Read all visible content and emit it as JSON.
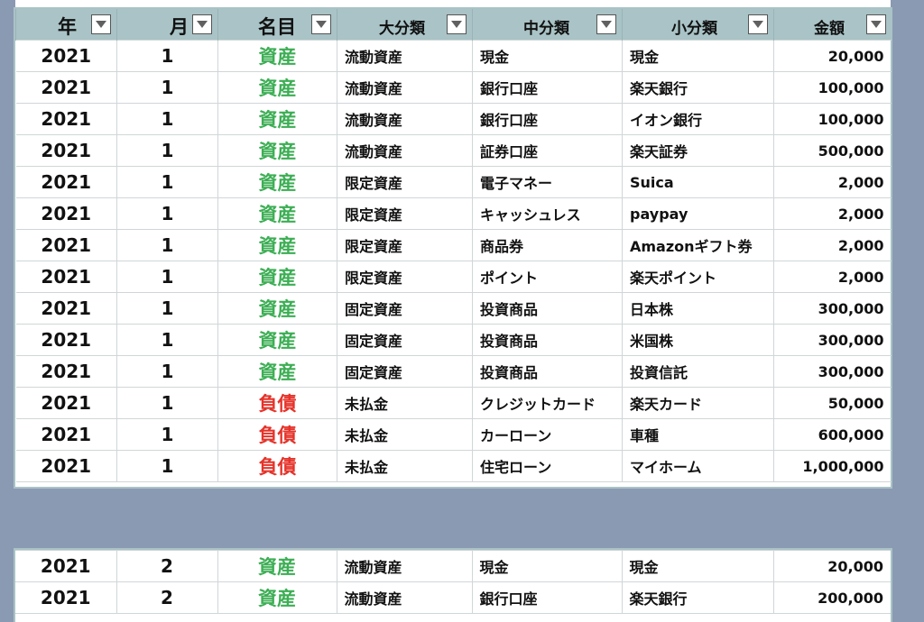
{
  "header": {
    "year": "年",
    "month": "月",
    "name": "名目",
    "major": "大分類",
    "middle": "中分類",
    "minor": "小分類",
    "amount": "金額"
  },
  "table1_rows": [
    {
      "year": "2021",
      "month": "1",
      "name": "資産",
      "type": "asset",
      "major": "流動資産",
      "middle": "現金",
      "minor": "現金",
      "amount": "20,000"
    },
    {
      "year": "2021",
      "month": "1",
      "name": "資産",
      "type": "asset",
      "major": "流動資産",
      "middle": "銀行口座",
      "minor": "楽天銀行",
      "amount": "100,000"
    },
    {
      "year": "2021",
      "month": "1",
      "name": "資産",
      "type": "asset",
      "major": "流動資産",
      "middle": "銀行口座",
      "minor": "イオン銀行",
      "amount": "100,000"
    },
    {
      "year": "2021",
      "month": "1",
      "name": "資産",
      "type": "asset",
      "major": "流動資産",
      "middle": "証券口座",
      "minor": "楽天証券",
      "amount": "500,000"
    },
    {
      "year": "2021",
      "month": "1",
      "name": "資産",
      "type": "asset",
      "major": "限定資産",
      "middle": "電子マネー",
      "minor": "Suica",
      "amount": "2,000"
    },
    {
      "year": "2021",
      "month": "1",
      "name": "資産",
      "type": "asset",
      "major": "限定資産",
      "middle": "キャッシュレス",
      "minor": "paypay",
      "amount": "2,000"
    },
    {
      "year": "2021",
      "month": "1",
      "name": "資産",
      "type": "asset",
      "major": "限定資産",
      "middle": "商品券",
      "minor": "Amazonギフト券",
      "amount": "2,000"
    },
    {
      "year": "2021",
      "month": "1",
      "name": "資産",
      "type": "asset",
      "major": "限定資産",
      "middle": "ポイント",
      "minor": "楽天ポイント",
      "amount": "2,000"
    },
    {
      "year": "2021",
      "month": "1",
      "name": "資産",
      "type": "asset",
      "major": "固定資産",
      "middle": "投資商品",
      "minor": "日本株",
      "amount": "300,000"
    },
    {
      "year": "2021",
      "month": "1",
      "name": "資産",
      "type": "asset",
      "major": "固定資産",
      "middle": "投資商品",
      "minor": "米国株",
      "amount": "300,000"
    },
    {
      "year": "2021",
      "month": "1",
      "name": "資産",
      "type": "asset",
      "major": "固定資産",
      "middle": "投資商品",
      "minor": "投資信託",
      "amount": "300,000"
    },
    {
      "year": "2021",
      "month": "1",
      "name": "負債",
      "type": "liability",
      "major": "未払金",
      "middle": "クレジットカード",
      "minor": "楽天カード",
      "amount": "50,000"
    },
    {
      "year": "2021",
      "month": "1",
      "name": "負債",
      "type": "liability",
      "major": "未払金",
      "middle": "カーローン",
      "minor": "車種",
      "amount": "600,000"
    },
    {
      "year": "2021",
      "month": "1",
      "name": "負債",
      "type": "liability",
      "major": "未払金",
      "middle": "住宅ローン",
      "minor": "マイホーム",
      "amount": "1,000,000"
    }
  ],
  "table2_rows": [
    {
      "year": "2021",
      "month": "2",
      "name": "資産",
      "type": "asset",
      "major": "流動資産",
      "middle": "現金",
      "minor": "現金",
      "amount": "20,000"
    },
    {
      "year": "2021",
      "month": "2",
      "name": "資産",
      "type": "asset",
      "major": "流動資産",
      "middle": "銀行口座",
      "minor": "楽天銀行",
      "amount": "200,000"
    }
  ],
  "colors": {
    "header_bg": "#a9c3c6",
    "background": "#8b9ab3",
    "asset_text": "#3cae54",
    "liability_text": "#e5332a"
  },
  "icons": {
    "filter": "filter-dropdown-icon"
  }
}
